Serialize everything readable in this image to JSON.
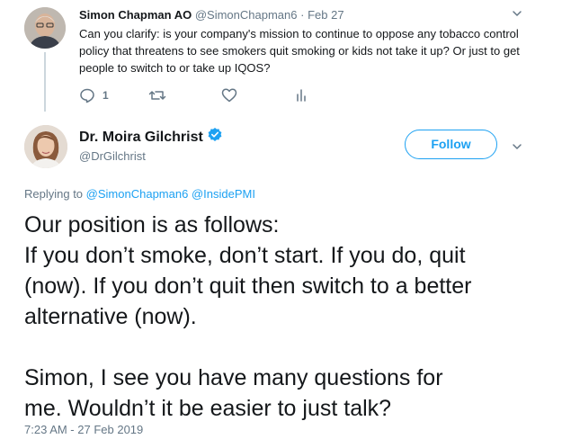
{
  "parent_tweet": {
    "author_name": "Simon Chapman AO",
    "author_handle": "@SimonChapman6",
    "separator": "·",
    "date": "Feb 27",
    "text": "Can you clarify: is your company's mission to continue to oppose any tobacco control policy that threatens to see smokers quit smoking or kids not take it up? Or just to get people to switch to or take up IQOS?",
    "reply_count": "1",
    "icons": [
      "reply-icon",
      "retweet-icon",
      "like-icon",
      "analytics-icon",
      "chevron-down-icon"
    ]
  },
  "main_tweet": {
    "author_name": "Dr. Moira Gilchrist",
    "author_handle": "@DrGilchrist",
    "follow_label": "Follow",
    "replying_prefix": "Replying to",
    "replying_mentions": [
      "@SimonChapman6",
      "@InsidePMI"
    ],
    "body_lines": [
      "Our position is as follows:",
      "If you don’t smoke, don’t start. If you do, quit",
      "(now). If you don’t quit then switch to a better",
      "alternative (now).",
      "",
      "Simon, I see you have many questions for",
      "me. Wouldn’t it be easier to just talk?"
    ],
    "timestamp": "7:23 AM - 27 Feb 2019",
    "icons": [
      "verified-badge-icon",
      "chevron-down-icon"
    ]
  },
  "colors": {
    "accent": "#1da1f2",
    "text_primary": "#14171a",
    "text_secondary": "#657786",
    "thread_line": "#ccd6dd"
  }
}
